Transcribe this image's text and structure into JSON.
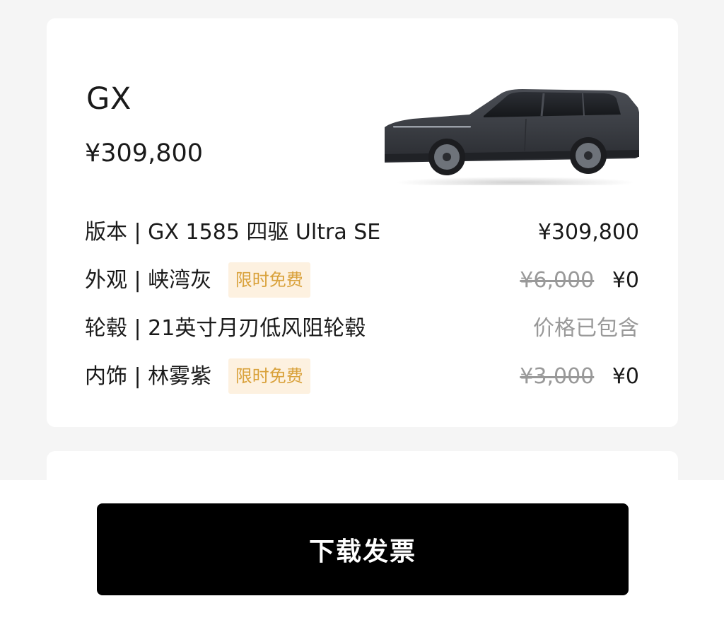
{
  "vehicle": {
    "model_name": "GX",
    "total_price": "¥309,800",
    "image_icon": "car-image",
    "body_color": "#3b3e44"
  },
  "config_rows": [
    {
      "category": "版本",
      "value": "GX 1585 四驱 Ultra SE",
      "label": "版本 | GX 1585 四驱 Ultra SE",
      "price": "¥309,800"
    },
    {
      "category": "外观",
      "value": "峡湾灰",
      "label": "外观 | 峡湾灰",
      "badge": "限时免费",
      "original_price": "¥6,000",
      "price": "¥0"
    },
    {
      "category": "轮毂",
      "value": "21英寸月刃低风阻轮毂",
      "label": "轮毂 | 21英寸月刃低风阻轮毂",
      "price_note": "价格已包含"
    },
    {
      "category": "内饰",
      "value": "林雾紫",
      "label": "内饰 | 林雾紫",
      "badge": "限时免费",
      "original_price": "¥3,000",
      "price": "¥0"
    }
  ],
  "actions": {
    "download_invoice_label": "下载发票"
  },
  "colors": {
    "background": "#f5f5f5",
    "card": "#ffffff",
    "badge_text": "#d9a13a",
    "badge_bg": "#fdf1e0",
    "muted_text": "#999999",
    "primary_button": "#000000"
  }
}
